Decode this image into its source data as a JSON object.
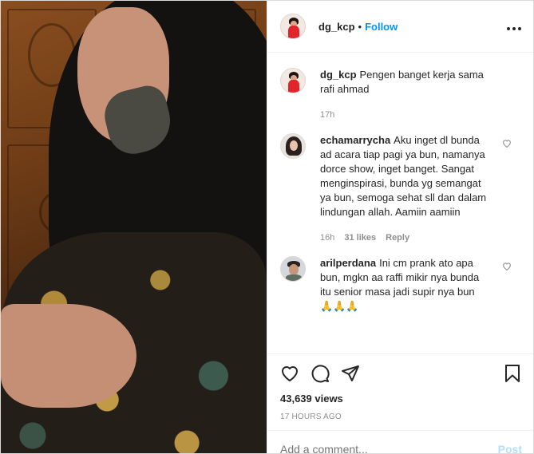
{
  "post": {
    "username": "dg_kcp",
    "separator": "•",
    "follow_label": "Follow",
    "more_icon": "more-icon",
    "caption": {
      "username": "dg_kcp",
      "text": "Pengen banget kerja sama rafi ahmad",
      "time": "17h"
    }
  },
  "comments": [
    {
      "username": "echamarrycha",
      "text": "Aku inget dl bunda ad acara tiap pagi ya bun, namanya dorce show, inget banget. Sangat menginspirasi, bunda yg semangat ya bun, semoga sehat sll dan dalam lindungan allah. Aamiin aamiin",
      "time": "16h",
      "likes": "31 likes",
      "reply": "Reply"
    },
    {
      "username": "arilperdana",
      "text": "Ini cm prank ato apa bun, mgkn aa raffi mikir nya bunda itu senior masa jadi supir nya bun 🙏🙏🙏"
    }
  ],
  "actions": {
    "icons": [
      "heart-icon",
      "comment-icon",
      "share-icon",
      "save-icon"
    ],
    "views": "43,639 views",
    "timestamp": "17 HOURS AGO"
  },
  "add_comment": {
    "placeholder": "Add a comment...",
    "post_label": "Post"
  },
  "colors": {
    "link": "#0095f6",
    "muted": "#8e8e8e",
    "post_disabled": "#b2dffc"
  }
}
